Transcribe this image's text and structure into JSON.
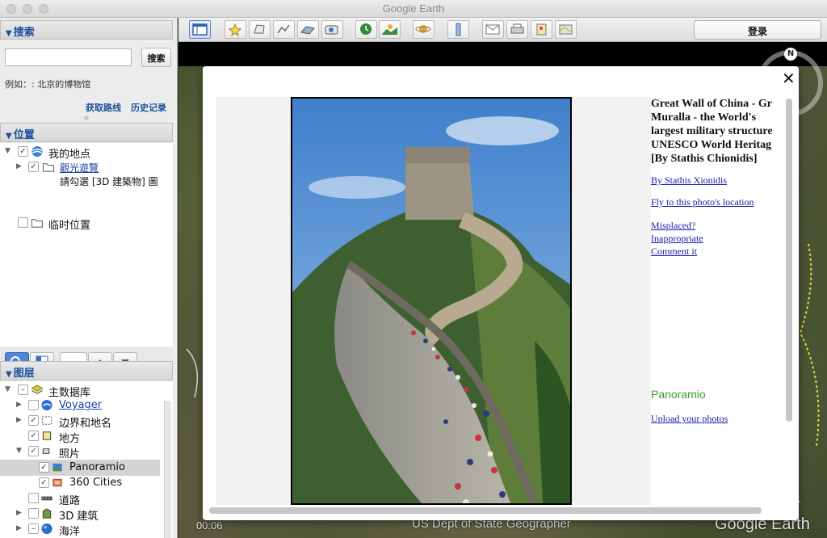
{
  "window": {
    "title": "Google Earth"
  },
  "search": {
    "header": "搜索",
    "button": "搜索",
    "placeholder": "",
    "hint": "例如：: 北京的博物馆",
    "get_directions": "获取路线",
    "history": "历史记录"
  },
  "places": {
    "header": "位置",
    "items": [
      {
        "label": "我的地点"
      },
      {
        "label": "觀光遊覽"
      },
      {
        "label": "請勾選 [3D 建築物] 圖"
      },
      {
        "label": "临时位置"
      }
    ]
  },
  "layers": {
    "header": "图层",
    "items": [
      {
        "label": "主数据库"
      },
      {
        "label": "Voyager"
      },
      {
        "label": "边界和地名"
      },
      {
        "label": "地方"
      },
      {
        "label": "照片"
      },
      {
        "label": "Panoramio"
      },
      {
        "label": "360 Cities"
      },
      {
        "label": "道路"
      },
      {
        "label": "3D 建筑"
      },
      {
        "label": "海洋"
      }
    ]
  },
  "toolbar": {
    "login": "登录"
  },
  "map": {
    "time": "00:06",
    "attribution": "US Dept of State Geographer",
    "brand": "Google Earth",
    "compass_n": "N"
  },
  "balloon": {
    "title": "Great Wall of China - Gr\nMuralla - the World's\nlargest military structure\nUNESCO World Heritag\n[By Stathis Chionidis]",
    "author_link": "By Stathis Xionidis",
    "fly_link": "Fly to this photo's location",
    "misplaced": "Misplaced?",
    "inappropriate": "Inappropriate",
    "comment": "Comment it",
    "logo": "Panoramio",
    "upload": "Upload your photos"
  }
}
